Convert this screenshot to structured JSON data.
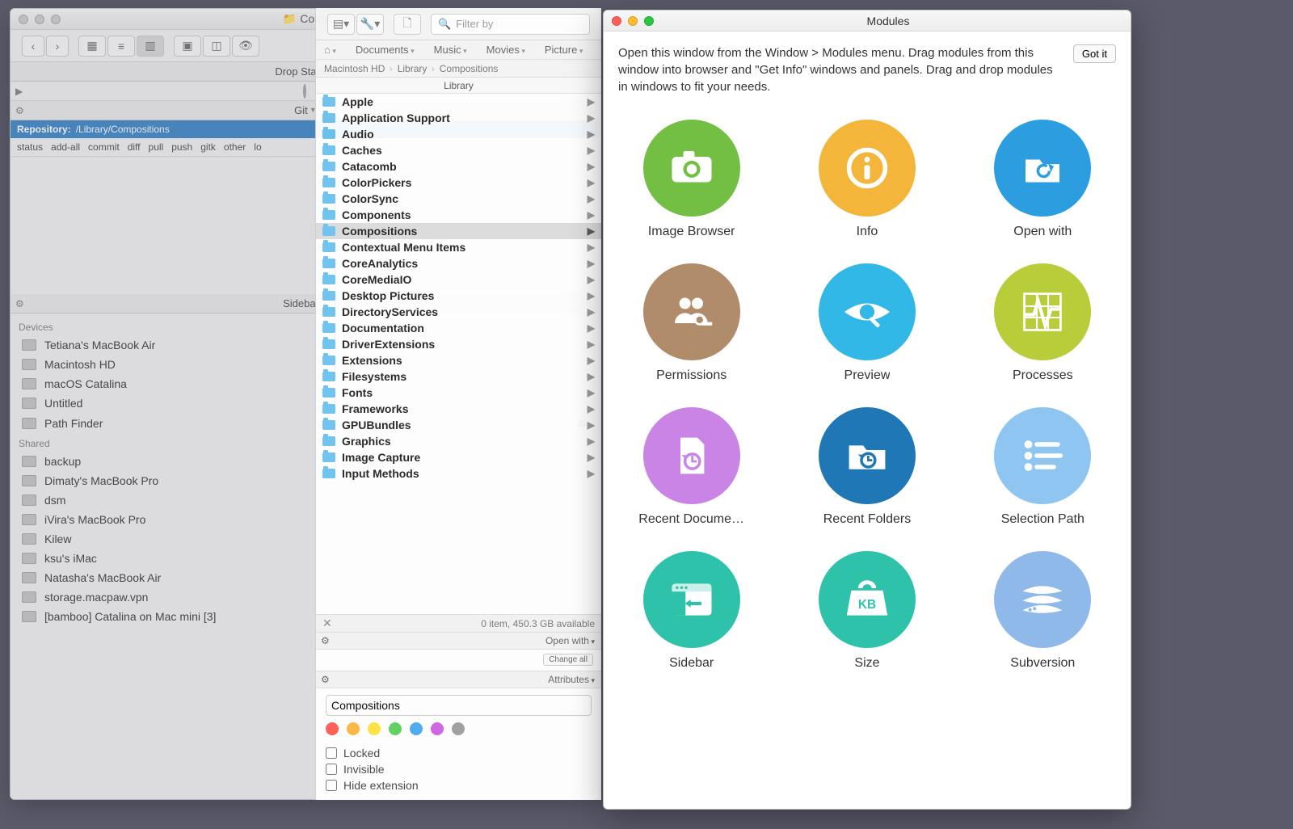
{
  "main_window": {
    "title": "Compositions",
    "search_placeholder": "Filter by",
    "drop_stack": {
      "title": "Drop Stack"
    },
    "git": {
      "title": "Git",
      "repo_label": "Repository:",
      "repo_path": "/Library/Compositions",
      "actions": [
        "status",
        "add-all",
        "commit",
        "diff",
        "pull",
        "push",
        "gitk",
        "other",
        "lo"
      ]
    },
    "sidebar": {
      "title": "Sidebar",
      "sections": [
        {
          "heading": "Devices",
          "items": [
            {
              "label": "Tetiana's MacBook Air",
              "icon": "laptop"
            },
            {
              "label": "Macintosh HD",
              "icon": "disk"
            },
            {
              "label": "macOS Catalina",
              "icon": "disk"
            },
            {
              "label": "Untitled",
              "icon": "disk"
            },
            {
              "label": "Path Finder",
              "icon": "disk",
              "eject": true
            }
          ]
        },
        {
          "heading": "Shared",
          "items": [
            {
              "label": "backup",
              "icon": "server"
            },
            {
              "label": "Dimaty's MacBook Pro",
              "icon": "laptop"
            },
            {
              "label": "dsm",
              "icon": "server"
            },
            {
              "label": "iVira's MacBook Pro",
              "icon": "laptop"
            },
            {
              "label": "Kilew",
              "icon": "laptop"
            },
            {
              "label": "ksu's iMac",
              "icon": "desktop"
            },
            {
              "label": "Natasha's MacBook Air",
              "icon": "laptop"
            },
            {
              "label": "storage.macpaw.vpn",
              "icon": "desktop"
            },
            {
              "label": "[bamboo] Catalina on Mac mini [3]",
              "icon": "desktop"
            }
          ]
        }
      ]
    },
    "pager": [
      "Documents",
      "Music",
      "Movies",
      "Picture"
    ],
    "breadcrumb": [
      "Macintosh HD",
      "Library",
      "Compositions"
    ],
    "column_header": "Library",
    "folders": [
      "Apple",
      "Application Support",
      "Audio",
      "Caches",
      "Catacomb",
      "ColorPickers",
      "ColorSync",
      "Components",
      "Compositions",
      "Contextual Menu Items",
      "CoreAnalytics",
      "CoreMediaIO",
      "Desktop Pictures",
      "DirectoryServices",
      "Documentation",
      "DriverExtensions",
      "Extensions",
      "Filesystems",
      "Fonts",
      "Frameworks",
      "GPUBundles",
      "Graphics",
      "Image Capture",
      "Input Methods"
    ],
    "selected_folder": "Compositions",
    "status_line": "0 item, 450.3 GB available",
    "open_with_label": "Open with",
    "change_all_label": "Change all",
    "attributes_label": "Attributes",
    "attr_name_value": "Compositions",
    "tag_colors": [
      "#ff5b50",
      "#ffb63d",
      "#ffe23d",
      "#5bd15b",
      "#4aa9f1",
      "#d061e3",
      "#9d9d9d"
    ],
    "checks": [
      "Locked",
      "Invisible",
      "Hide extension"
    ]
  },
  "modules_window": {
    "title": "Modules",
    "intro": "Open this window from the Window > Modules menu. Drag modules from this window into browser and \"Get Info\" windows and panels. Drag and drop modules in windows to fit your needs.",
    "got_it": "Got it",
    "modules": [
      {
        "label": "Image Browser",
        "color": "#73bf44",
        "icon": "camera"
      },
      {
        "label": "Info",
        "color": "#f3b63a",
        "icon": "info"
      },
      {
        "label": "Open with",
        "color": "#2c9ee0",
        "icon": "open"
      },
      {
        "label": "Permissions",
        "color": "#b18c6b",
        "icon": "perm"
      },
      {
        "label": "Preview",
        "color": "#32b8e7",
        "icon": "eye"
      },
      {
        "label": "Processes",
        "color": "#b9cc3a",
        "icon": "proc"
      },
      {
        "label": "Recent Docume…",
        "color": "#c984e6",
        "icon": "recdoc"
      },
      {
        "label": "Recent Folders",
        "color": "#1f78b5",
        "icon": "recfold"
      },
      {
        "label": "Selection Path",
        "color": "#8fc6f1",
        "icon": "selpath"
      },
      {
        "label": "Sidebar",
        "color": "#2fc2aa",
        "icon": "sidebar"
      },
      {
        "label": "Size",
        "color": "#2fc2aa",
        "icon": "size"
      },
      {
        "label": "Subversion",
        "color": "#8fb9e8",
        "icon": "svn"
      }
    ]
  }
}
